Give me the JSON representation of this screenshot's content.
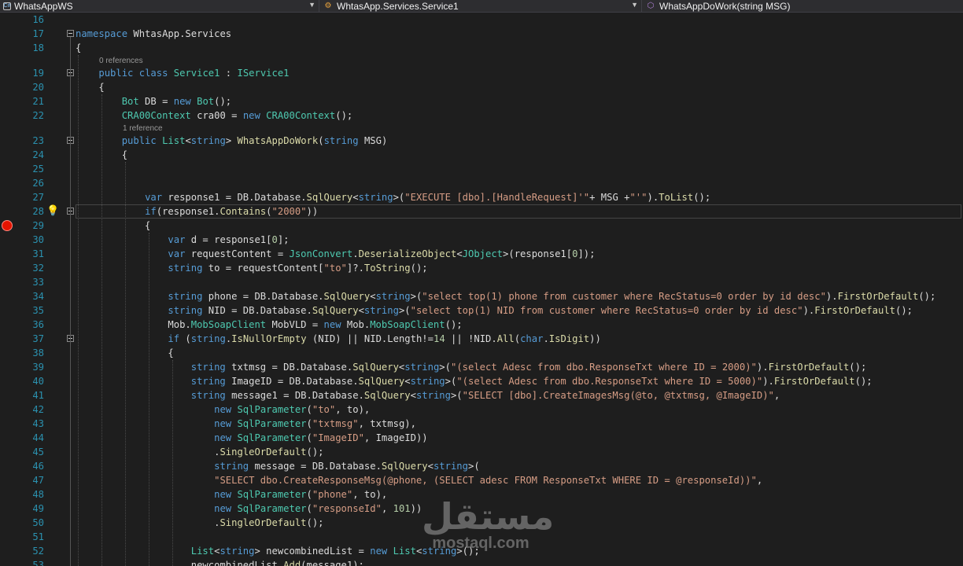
{
  "navbar": {
    "project": "WhatsAppWS",
    "type": "WhtasApp.Services.Service1",
    "member": "WhatsAppDoWork(string MSG)"
  },
  "icons": {
    "project": "project-icon",
    "type": "class-icon",
    "member": "method-icon",
    "lightbulb": "lightbulb-icon",
    "breakpoint": "breakpoint-icon"
  },
  "colors": {
    "keyword": "#569cd6",
    "type": "#4ec9b0",
    "string": "#d69d85",
    "number": "#b5cea8",
    "method": "#dcdcaa",
    "line_number": "#2b91af",
    "breakpoint": "#e51400"
  },
  "code_lens": {
    "class_refs": "0 references",
    "method_refs": "1 reference"
  },
  "lines": [
    {
      "n": "16",
      "t": []
    },
    {
      "n": "17",
      "t": [
        [
          "kw",
          "namespace"
        ],
        [
          "pl",
          " WhtasApp.Services"
        ]
      ]
    },
    {
      "n": "18",
      "t": [
        [
          "pl",
          "{"
        ]
      ]
    },
    {
      "n": "19",
      "t": [
        [
          "pl",
          "    "
        ],
        [
          "kw",
          "public"
        ],
        [
          "pl",
          " "
        ],
        [
          "kw",
          "class"
        ],
        [
          "pl",
          " "
        ],
        [
          "ty",
          "Service1"
        ],
        [
          "pl",
          " : "
        ],
        [
          "ty",
          "IService1"
        ]
      ]
    },
    {
      "n": "20",
      "t": [
        [
          "pl",
          "    {"
        ]
      ]
    },
    {
      "n": "21",
      "t": [
        [
          "pl",
          "        "
        ],
        [
          "ty",
          "Bot"
        ],
        [
          "pl",
          " DB = "
        ],
        [
          "kw",
          "new"
        ],
        [
          "pl",
          " "
        ],
        [
          "ty",
          "Bot"
        ],
        [
          "pl",
          "();"
        ]
      ]
    },
    {
      "n": "22",
      "t": [
        [
          "pl",
          "        "
        ],
        [
          "ty",
          "CRA00Context"
        ],
        [
          "pl",
          " cra00 = "
        ],
        [
          "kw",
          "new"
        ],
        [
          "pl",
          " "
        ],
        [
          "ty",
          "CRA00Context"
        ],
        [
          "pl",
          "();"
        ]
      ]
    },
    {
      "n": "23",
      "t": [
        [
          "pl",
          "        "
        ],
        [
          "kw",
          "public"
        ],
        [
          "pl",
          " "
        ],
        [
          "ty",
          "List"
        ],
        [
          "pl",
          "<"
        ],
        [
          "kw",
          "string"
        ],
        [
          "pl",
          "> "
        ],
        [
          "me",
          "WhatsAppDoWork"
        ],
        [
          "pl",
          "("
        ],
        [
          "kw",
          "string"
        ],
        [
          "pl",
          " MSG)"
        ]
      ]
    },
    {
      "n": "24",
      "t": [
        [
          "pl",
          "        {"
        ]
      ]
    },
    {
      "n": "25",
      "t": []
    },
    {
      "n": "26",
      "t": []
    },
    {
      "n": "27",
      "t": [
        [
          "pl",
          "            "
        ],
        [
          "kw",
          "var"
        ],
        [
          "pl",
          " response1 = DB.Database."
        ],
        [
          "me",
          "SqlQuery"
        ],
        [
          "pl",
          "<"
        ],
        [
          "kw",
          "string"
        ],
        [
          "pl",
          ">("
        ],
        [
          "st",
          "\"EXECUTE [dbo].[HandleRequest]'\""
        ],
        [
          "pl",
          "+ MSG +"
        ],
        [
          "st",
          "\"'\""
        ],
        [
          "pl",
          ")."
        ],
        [
          "me",
          "ToList"
        ],
        [
          "pl",
          "();"
        ]
      ]
    },
    {
      "n": "28",
      "t": [
        [
          "pl",
          "            "
        ],
        [
          "kw",
          "if"
        ],
        [
          "pl",
          "(response1."
        ],
        [
          "me",
          "Contains"
        ],
        [
          "pl",
          "("
        ],
        [
          "st",
          "\"2000\""
        ],
        [
          "pl",
          "))"
        ]
      ]
    },
    {
      "n": "29",
      "t": [
        [
          "pl",
          "            {"
        ]
      ]
    },
    {
      "n": "30",
      "t": [
        [
          "pl",
          "                "
        ],
        [
          "kw",
          "var"
        ],
        [
          "pl",
          " d = response1["
        ],
        [
          "nu",
          "0"
        ],
        [
          "pl",
          "];"
        ]
      ]
    },
    {
      "n": "31",
      "t": [
        [
          "pl",
          "                "
        ],
        [
          "kw",
          "var"
        ],
        [
          "pl",
          " requestContent = "
        ],
        [
          "ty",
          "JsonConvert"
        ],
        [
          "pl",
          "."
        ],
        [
          "me",
          "DeserializeObject"
        ],
        [
          "pl",
          "<"
        ],
        [
          "ty",
          "JObject"
        ],
        [
          "pl",
          ">(response1["
        ],
        [
          "nu",
          "0"
        ],
        [
          "pl",
          "]);"
        ]
      ]
    },
    {
      "n": "32",
      "t": [
        [
          "pl",
          "                "
        ],
        [
          "kw",
          "string"
        ],
        [
          "pl",
          " to = requestContent["
        ],
        [
          "st",
          "\"to\""
        ],
        [
          "pl",
          "]?."
        ],
        [
          "me",
          "ToString"
        ],
        [
          "pl",
          "();"
        ]
      ]
    },
    {
      "n": "33",
      "t": []
    },
    {
      "n": "34",
      "t": [
        [
          "pl",
          "                "
        ],
        [
          "kw",
          "string"
        ],
        [
          "pl",
          " phone = DB.Database."
        ],
        [
          "me",
          "SqlQuery"
        ],
        [
          "pl",
          "<"
        ],
        [
          "kw",
          "string"
        ],
        [
          "pl",
          ">("
        ],
        [
          "st",
          "\"select top(1) phone from customer where RecStatus=0 order by id desc\""
        ],
        [
          "pl",
          ")."
        ],
        [
          "me",
          "FirstOrDefault"
        ],
        [
          "pl",
          "();"
        ]
      ]
    },
    {
      "n": "35",
      "t": [
        [
          "pl",
          "                "
        ],
        [
          "kw",
          "string"
        ],
        [
          "pl",
          " NID = DB.Database."
        ],
        [
          "me",
          "SqlQuery"
        ],
        [
          "pl",
          "<"
        ],
        [
          "kw",
          "string"
        ],
        [
          "pl",
          ">("
        ],
        [
          "st",
          "\"select top(1) NID from customer where RecStatus=0 order by id desc\""
        ],
        [
          "pl",
          ")."
        ],
        [
          "me",
          "FirstOrDefault"
        ],
        [
          "pl",
          "();"
        ]
      ]
    },
    {
      "n": "36",
      "t": [
        [
          "pl",
          "                Mob."
        ],
        [
          "ty",
          "MobSoapClient"
        ],
        [
          "pl",
          " MobVLD = "
        ],
        [
          "kw",
          "new"
        ],
        [
          "pl",
          " Mob."
        ],
        [
          "ty",
          "MobSoapClient"
        ],
        [
          "pl",
          "();"
        ]
      ]
    },
    {
      "n": "37",
      "t": [
        [
          "pl",
          "                "
        ],
        [
          "kw",
          "if"
        ],
        [
          "pl",
          " ("
        ],
        [
          "kw",
          "string"
        ],
        [
          "pl",
          "."
        ],
        [
          "me",
          "IsNullOrEmpty"
        ],
        [
          "pl",
          " (NID) || NID.Length!="
        ],
        [
          "nu",
          "14"
        ],
        [
          "pl",
          " || !NID."
        ],
        [
          "me",
          "All"
        ],
        [
          "pl",
          "("
        ],
        [
          "kw",
          "char"
        ],
        [
          "pl",
          "."
        ],
        [
          "me",
          "IsDigit"
        ],
        [
          "pl",
          "))"
        ]
      ]
    },
    {
      "n": "38",
      "t": [
        [
          "pl",
          "                {"
        ]
      ]
    },
    {
      "n": "39",
      "t": [
        [
          "pl",
          "                    "
        ],
        [
          "kw",
          "string"
        ],
        [
          "pl",
          " txtmsg = DB.Database."
        ],
        [
          "me",
          "SqlQuery"
        ],
        [
          "pl",
          "<"
        ],
        [
          "kw",
          "string"
        ],
        [
          "pl",
          ">("
        ],
        [
          "st",
          "\"(select Adesc from dbo.ResponseTxt where ID = 2000)\""
        ],
        [
          "pl",
          ")."
        ],
        [
          "me",
          "FirstOrDefault"
        ],
        [
          "pl",
          "();"
        ]
      ]
    },
    {
      "n": "40",
      "t": [
        [
          "pl",
          "                    "
        ],
        [
          "kw",
          "string"
        ],
        [
          "pl",
          " ImageID = DB.Database."
        ],
        [
          "me",
          "SqlQuery"
        ],
        [
          "pl",
          "<"
        ],
        [
          "kw",
          "string"
        ],
        [
          "pl",
          ">("
        ],
        [
          "st",
          "\"(select Adesc from dbo.ResponseTxt where ID = 5000)\""
        ],
        [
          "pl",
          ")."
        ],
        [
          "me",
          "FirstOrDefault"
        ],
        [
          "pl",
          "();"
        ]
      ]
    },
    {
      "n": "41",
      "t": [
        [
          "pl",
          "                    "
        ],
        [
          "kw",
          "string"
        ],
        [
          "pl",
          " message1 = DB.Database."
        ],
        [
          "me",
          "SqlQuery"
        ],
        [
          "pl",
          "<"
        ],
        [
          "kw",
          "string"
        ],
        [
          "pl",
          ">("
        ],
        [
          "st",
          "\"SELECT [dbo].CreateImagesMsg(@to, @txtmsg, @ImageID)\""
        ],
        [
          "pl",
          ","
        ]
      ]
    },
    {
      "n": "42",
      "t": [
        [
          "pl",
          "                        "
        ],
        [
          "kw",
          "new"
        ],
        [
          "pl",
          " "
        ],
        [
          "ty",
          "SqlParameter"
        ],
        [
          "pl",
          "("
        ],
        [
          "st",
          "\"to\""
        ],
        [
          "pl",
          ", to),"
        ]
      ]
    },
    {
      "n": "43",
      "t": [
        [
          "pl",
          "                        "
        ],
        [
          "kw",
          "new"
        ],
        [
          "pl",
          " "
        ],
        [
          "ty",
          "SqlParameter"
        ],
        [
          "pl",
          "("
        ],
        [
          "st",
          "\"txtmsg\""
        ],
        [
          "pl",
          ", txtmsg),"
        ]
      ]
    },
    {
      "n": "44",
      "t": [
        [
          "pl",
          "                        "
        ],
        [
          "kw",
          "new"
        ],
        [
          "pl",
          " "
        ],
        [
          "ty",
          "SqlParameter"
        ],
        [
          "pl",
          "("
        ],
        [
          "st",
          "\"ImageID\""
        ],
        [
          "pl",
          ", ImageID))"
        ]
      ]
    },
    {
      "n": "45",
      "t": [
        [
          "pl",
          "                        ."
        ],
        [
          "me",
          "SingleOrDefault"
        ],
        [
          "pl",
          "();"
        ]
      ]
    },
    {
      "n": "46",
      "t": [
        [
          "pl",
          "                        "
        ],
        [
          "kw",
          "string"
        ],
        [
          "pl",
          " message = DB.Database."
        ],
        [
          "me",
          "SqlQuery"
        ],
        [
          "pl",
          "<"
        ],
        [
          "kw",
          "string"
        ],
        [
          "pl",
          ">("
        ]
      ]
    },
    {
      "n": "47",
      "t": [
        [
          "pl",
          "                        "
        ],
        [
          "st",
          "\"SELECT dbo.CreateResponseMsg(@phone, (SELECT adesc FROM ResponseTxt WHERE ID = @responseId))\""
        ],
        [
          "pl",
          ","
        ]
      ]
    },
    {
      "n": "48",
      "t": [
        [
          "pl",
          "                        "
        ],
        [
          "kw",
          "new"
        ],
        [
          "pl",
          " "
        ],
        [
          "ty",
          "SqlParameter"
        ],
        [
          "pl",
          "("
        ],
        [
          "st",
          "\"phone\""
        ],
        [
          "pl",
          ", to),"
        ]
      ]
    },
    {
      "n": "49",
      "t": [
        [
          "pl",
          "                        "
        ],
        [
          "kw",
          "new"
        ],
        [
          "pl",
          " "
        ],
        [
          "ty",
          "SqlParameter"
        ],
        [
          "pl",
          "("
        ],
        [
          "st",
          "\"responseId\""
        ],
        [
          "pl",
          ", "
        ],
        [
          "nu",
          "101"
        ],
        [
          "pl",
          "))"
        ]
      ]
    },
    {
      "n": "50",
      "t": [
        [
          "pl",
          "                        ."
        ],
        [
          "me",
          "SingleOrDefault"
        ],
        [
          "pl",
          "();"
        ]
      ]
    },
    {
      "n": "51",
      "t": []
    },
    {
      "n": "52",
      "t": [
        [
          "pl",
          "                    "
        ],
        [
          "ty",
          "List"
        ],
        [
          "pl",
          "<"
        ],
        [
          "kw",
          "string"
        ],
        [
          "pl",
          "> newcombinedList = "
        ],
        [
          "kw",
          "new"
        ],
        [
          "pl",
          " "
        ],
        [
          "ty",
          "List"
        ],
        [
          "pl",
          "<"
        ],
        [
          "kw",
          "string"
        ],
        [
          "pl",
          ">();"
        ]
      ]
    },
    {
      "n": "53",
      "t": [
        [
          "pl",
          "                    newcombinedList."
        ],
        [
          "me",
          "Add"
        ],
        [
          "pl",
          "(message1);"
        ]
      ]
    }
  ],
  "watermark": {
    "arabic": "مستقل",
    "url": "mostaql.com"
  }
}
